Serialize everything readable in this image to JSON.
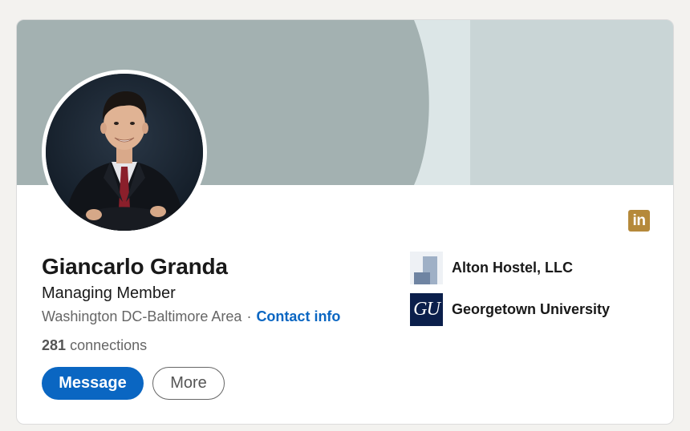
{
  "profile": {
    "name": "Giancarlo Granda",
    "headline": "Managing Member",
    "location": "Washington DC-Baltimore Area",
    "separator": "·",
    "contact_link": "Contact info",
    "connections_count": "281",
    "connections_label": "connections"
  },
  "actions": {
    "message_label": "Message",
    "more_label": "More"
  },
  "organizations": [
    {
      "name": "Alton Hostel, LLC",
      "icon": "company-logo-icon"
    },
    {
      "name": "Georgetown University",
      "icon": "georgetown-logo-icon",
      "logo_text": "GU"
    }
  ],
  "badge": {
    "text": "in",
    "icon": "linkedin-icon",
    "color": "#b5893a"
  },
  "colors": {
    "accent": "#0a66c2",
    "banner": "#c9d5d6",
    "georgetown_blue": "#0b1f4b"
  }
}
